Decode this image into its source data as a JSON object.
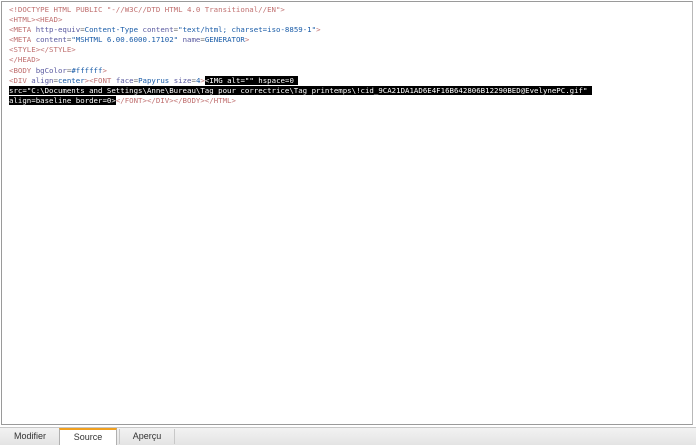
{
  "editor": {
    "lines": [
      [
        {
          "c": "t",
          "x": "<!DOCTYPE HTML PUBLIC \"-//W3C//DTD HTML 4.0 Transitional//EN\">"
        }
      ],
      [
        {
          "c": "t",
          "x": "<HTML><HEAD>"
        }
      ],
      [
        {
          "c": "t",
          "x": "<META "
        },
        {
          "c": "a",
          "x": "http-equiv"
        },
        {
          "c": "p",
          "x": "="
        },
        {
          "c": "v",
          "x": "Content-Type "
        },
        {
          "c": "a",
          "x": "content"
        },
        {
          "c": "p",
          "x": "="
        },
        {
          "c": "v",
          "x": "\"text/html; charset=iso-8859-1\""
        },
        {
          "c": "t",
          "x": ">"
        }
      ],
      [
        {
          "c": "t",
          "x": "<META "
        },
        {
          "c": "a",
          "x": "content"
        },
        {
          "c": "p",
          "x": "="
        },
        {
          "c": "v",
          "x": "\"MSHTML 6.00.6000.17102\" "
        },
        {
          "c": "a",
          "x": "name"
        },
        {
          "c": "p",
          "x": "="
        },
        {
          "c": "v",
          "x": "GENERATOR"
        },
        {
          "c": "t",
          "x": ">"
        }
      ],
      [
        {
          "c": "t",
          "x": "<STYLE></STYLE>"
        }
      ],
      [
        {
          "c": "t",
          "x": "</HEAD>"
        }
      ],
      [
        {
          "c": "t",
          "x": "<BODY "
        },
        {
          "c": "a",
          "x": "bgColor"
        },
        {
          "c": "p",
          "x": "="
        },
        {
          "c": "v",
          "x": "#ffffff"
        },
        {
          "c": "t",
          "x": ">"
        }
      ],
      [
        {
          "c": "t",
          "x": "<DIV "
        },
        {
          "c": "a",
          "x": "align"
        },
        {
          "c": "p",
          "x": "="
        },
        {
          "c": "v",
          "x": "center"
        },
        {
          "c": "t",
          "x": "><FONT "
        },
        {
          "c": "a",
          "x": "face"
        },
        {
          "c": "p",
          "x": "="
        },
        {
          "c": "v",
          "x": "Papyrus "
        },
        {
          "c": "a",
          "x": "size"
        },
        {
          "c": "p",
          "x": "="
        },
        {
          "c": "v",
          "x": "4"
        },
        {
          "c": "t",
          "x": ">"
        },
        {
          "c": "sel-tag",
          "x": "<IMG "
        },
        {
          "c": "sel-attr",
          "x": "alt"
        },
        {
          "c": "sel-attr",
          "x": "="
        },
        {
          "c": "sel-val",
          "x": "\"\" "
        },
        {
          "c": "sel-attr",
          "x": "hspace"
        },
        {
          "c": "sel-attr",
          "x": "="
        },
        {
          "c": "sel-val",
          "x": "0 "
        }
      ],
      [
        {
          "c": "sel-attr",
          "x": "src"
        },
        {
          "c": "sel-attr",
          "x": "="
        },
        {
          "c": "sel-val",
          "x": "\"C:\\Documents and Settings\\Anne\\Bureau\\Tag pour correctrice\\Tag printemps\\!cid_9CA21DA1AD6E4F16B642806B12290BED@EvelynePC.gif\" "
        }
      ],
      [
        {
          "c": "sel-attr",
          "x": "align"
        },
        {
          "c": "sel-attr",
          "x": "="
        },
        {
          "c": "sel-val",
          "x": "baseline "
        },
        {
          "c": "sel-attr",
          "x": "border"
        },
        {
          "c": "sel-attr",
          "x": "="
        },
        {
          "c": "sel-val",
          "x": "0"
        },
        {
          "c": "sel-tag",
          "x": ">"
        },
        {
          "c": "t",
          "x": "</FONT></DIV></BODY></HTML>"
        }
      ]
    ]
  },
  "tabs": {
    "modifier": "Modifier",
    "source": "Source",
    "apercu": "Aperçu"
  }
}
